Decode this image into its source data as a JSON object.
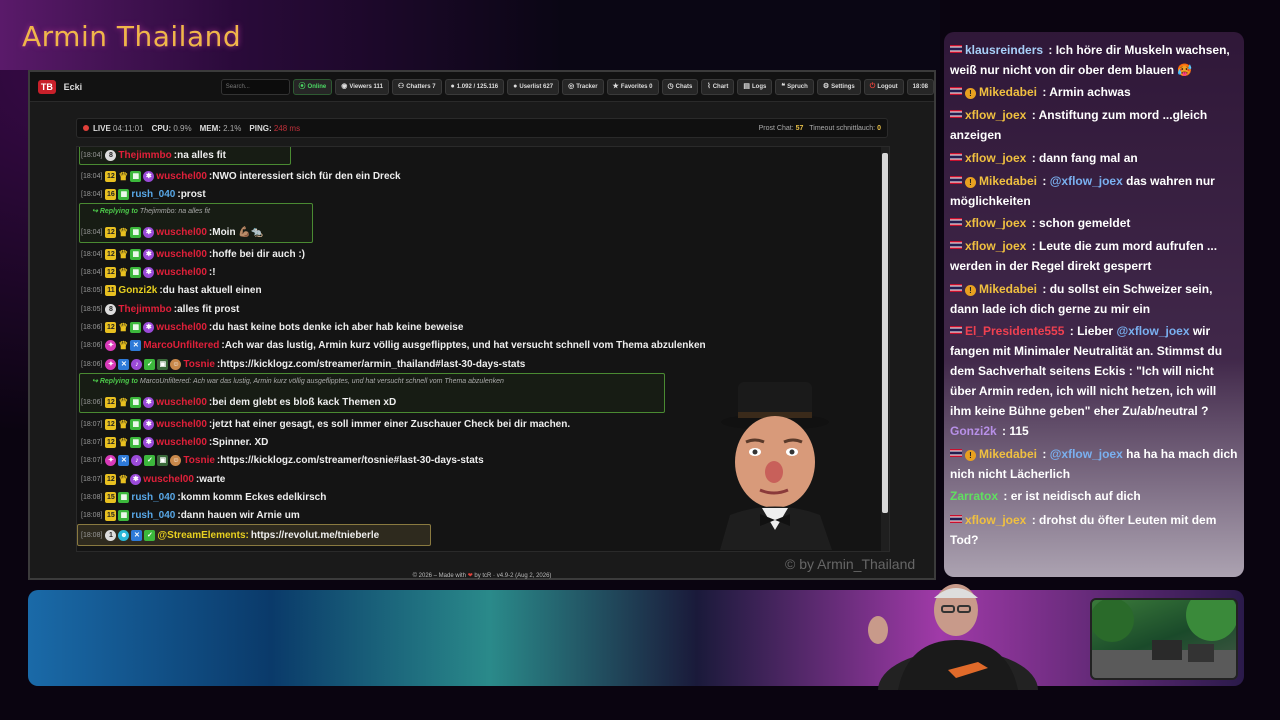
{
  "stream": {
    "title": "Armin Thailand",
    "watermark": "© by Armin_Thailand"
  },
  "app": {
    "logo": "TB",
    "name": "Ecki",
    "search_placeholder": "Search...",
    "nav": [
      {
        "icon": "wifi-icon",
        "glyph": "⦿",
        "label": "Online"
      },
      {
        "icon": "eye-icon",
        "glyph": "◉",
        "label": "Viewers 111"
      },
      {
        "icon": "users-icon",
        "glyph": "⚇",
        "label": "Chatters 7"
      },
      {
        "icon": "chat-icon",
        "glyph": "●",
        "label": "1.092 / 125.116"
      },
      {
        "icon": "user-icon",
        "glyph": "●",
        "label": "Userlist 627"
      },
      {
        "icon": "tracker-icon",
        "glyph": "◎",
        "label": "Tracker"
      },
      {
        "icon": "star-icon",
        "glyph": "★",
        "label": "Favorites 0"
      },
      {
        "icon": "clock-icon",
        "glyph": "◷",
        "label": "Chats"
      },
      {
        "icon": "chart-icon",
        "glyph": "⌇",
        "label": "Chart"
      },
      {
        "icon": "file-icon",
        "glyph": "▤",
        "label": "Logs"
      },
      {
        "icon": "quote-icon",
        "glyph": "❝",
        "label": "Spruch"
      },
      {
        "icon": "gear-icon",
        "glyph": "⚙",
        "label": "Settings"
      },
      {
        "icon": "logout-icon",
        "glyph": "⏻",
        "label": "Logout"
      }
    ],
    "clock": "18:08"
  },
  "status": {
    "live_label": "LIVE",
    "live_time": "04:11:01",
    "cpu_label": "CPU:",
    "cpu_value": "0.9%",
    "mem_label": "MEM:",
    "mem_value": "2.1%",
    "ping_label": "PING:",
    "ping_value": "248 ms",
    "prost_label": "Prost Chat:",
    "prost_value": "57",
    "timeout_label": "Timeout schnittlauch:",
    "timeout_value": "0"
  },
  "chat": [
    {
      "ts": "[18:04]",
      "user": "Thejimmbo",
      "text": "na alles fit"
    },
    {
      "ts": "[18:04]",
      "user": "wuschel00",
      "text": "NWO interessiert sich für den ein Dreck"
    },
    {
      "ts": "[18:04]",
      "badge": "16",
      "user": "rush_040",
      "text": "prost"
    },
    {
      "reply": "Replying to",
      "reply_to": "Thejimmbo: na alles fit",
      "ts": "[18:04]",
      "user": "wuschel00",
      "text": "Moin 💪🏽🐀"
    },
    {
      "ts": "[18:04]",
      "user": "wuschel00",
      "text": "hoffe bei dir auch :)"
    },
    {
      "ts": "[18:04]",
      "user": "wuschel00",
      "text": "!"
    },
    {
      "ts": "[18:05]",
      "badge": "11",
      "user": "Gonzi2k",
      "text": "du hast aktuell einen"
    },
    {
      "ts": "[18:05]",
      "user": "Thejimmbo",
      "text": "alles fit prost"
    },
    {
      "ts": "[18:06]",
      "user": "wuschel00",
      "text": "du hast keine bots denke ich aber hab keine beweise"
    },
    {
      "ts": "[18:06]",
      "user": "MarcoUnfiltered",
      "text": "Ach war das lustig, Armin kurz völlig ausgeflipptes, und hat versucht schnell vom Thema abzulenken"
    },
    {
      "ts": "[18:06]",
      "user": "Tosnie",
      "text": "https://kicklogz.com/streamer/armin_thailand#last-30-days-stats"
    },
    {
      "reply": "Replying to",
      "reply_to": "MarcoUnfiltered: Ach war das lustig, Armin kurz völlig ausgeflipptes, und hat versucht schnell vom Thema abzulenken",
      "ts": "[18:06]",
      "user": "wuschel00",
      "text": "bei dem glebt es bloß kack Themen xD"
    },
    {
      "ts": "[18:07]",
      "user": "wuschel00",
      "text": "jetzt hat einer gesagt, es soll immer einer Zuschauer Check bei dir machen."
    },
    {
      "ts": "[18:07]",
      "user": "wuschel00",
      "text": "Spinner. XD"
    },
    {
      "ts": "[18:07]",
      "user": "Tosnie",
      "text": "https://kicklogz.com/streamer/tosnie#last-30-days-stats"
    },
    {
      "ts": "[18:07]",
      "user": "wuschel00",
      "text": "warte"
    },
    {
      "ts": "[18:08]",
      "badge": "15",
      "user": "rush_040",
      "text": "komm komm Eckes edelkirsch"
    },
    {
      "ts": "[18:08]",
      "badge": "15",
      "user": "rush_040",
      "text": "dann hauen wir Arnie um"
    },
    {
      "ts": "[18:08]",
      "user": "@StreamElements:",
      "text": "https://revolut.me/tnieberle"
    }
  ],
  "footer": {
    "pre": "© 2026 – Made with",
    "heart": "❤",
    "post": "by tcR · v4.9-2 (Aug 2, 2026)"
  },
  "overlay": [
    {
      "user": "klausreinders",
      "text": ": Ich höre dir Muskeln wachsen, weiß nur nicht von dir ober dem blauen 🥵"
    },
    {
      "user": "Mikedabei",
      "text": ": Armin achwas"
    },
    {
      "user": "xflow_joex",
      "text": ": Anstiftung zum mord ...gleich anzeigen"
    },
    {
      "user": "xflow_joex",
      "text": ": dann fang mal an"
    },
    {
      "user": "Mikedabei",
      "pre": ":",
      "mention": "@xflow_joex",
      "text": "das wahren nur möglichkeiten"
    },
    {
      "user": "xflow_joex",
      "text": ": schon gemeldet"
    },
    {
      "user": "xflow_joex",
      "text": ": Leute die zum mord aufrufen ... werden in der Regel direkt gesperrt"
    },
    {
      "user": "Mikedabei",
      "text": ": du sollst ein Schweizer sein, dann lade ich dich gerne zu mir ein"
    },
    {
      "user": "El_Presidente555",
      "pre": ": Lieber",
      "mention": "@xflow_joex",
      "text": "wir fangen mit Minimaler Neutralität an. Stimmst du dem Sachverhalt seitens Eckis : \"Ich will nicht über Armin reden, ich will nicht hetzen, ich will ihm keine Bühne geben\" eher Zu/ab/neutral ?"
    },
    {
      "user": "Gonzi2k",
      "text": ": 115"
    },
    {
      "user": "Mikedabei",
      "pre": ":",
      "mention": "@xflow_joex",
      "text": "ha ha ha mach dich nich nicht Lächerlich"
    },
    {
      "user": "Zarratox",
      "text": ": er ist neidisch auf dich"
    },
    {
      "user": "xflow_joex",
      "text": ": drohst du öfter Leuten mit dem Tod?"
    }
  ],
  "colors": {
    "accent_gold": "#f0b64a",
    "online_green": "#4cd964",
    "user_red": "#e0203a",
    "reply_green": "#4a8a32"
  }
}
